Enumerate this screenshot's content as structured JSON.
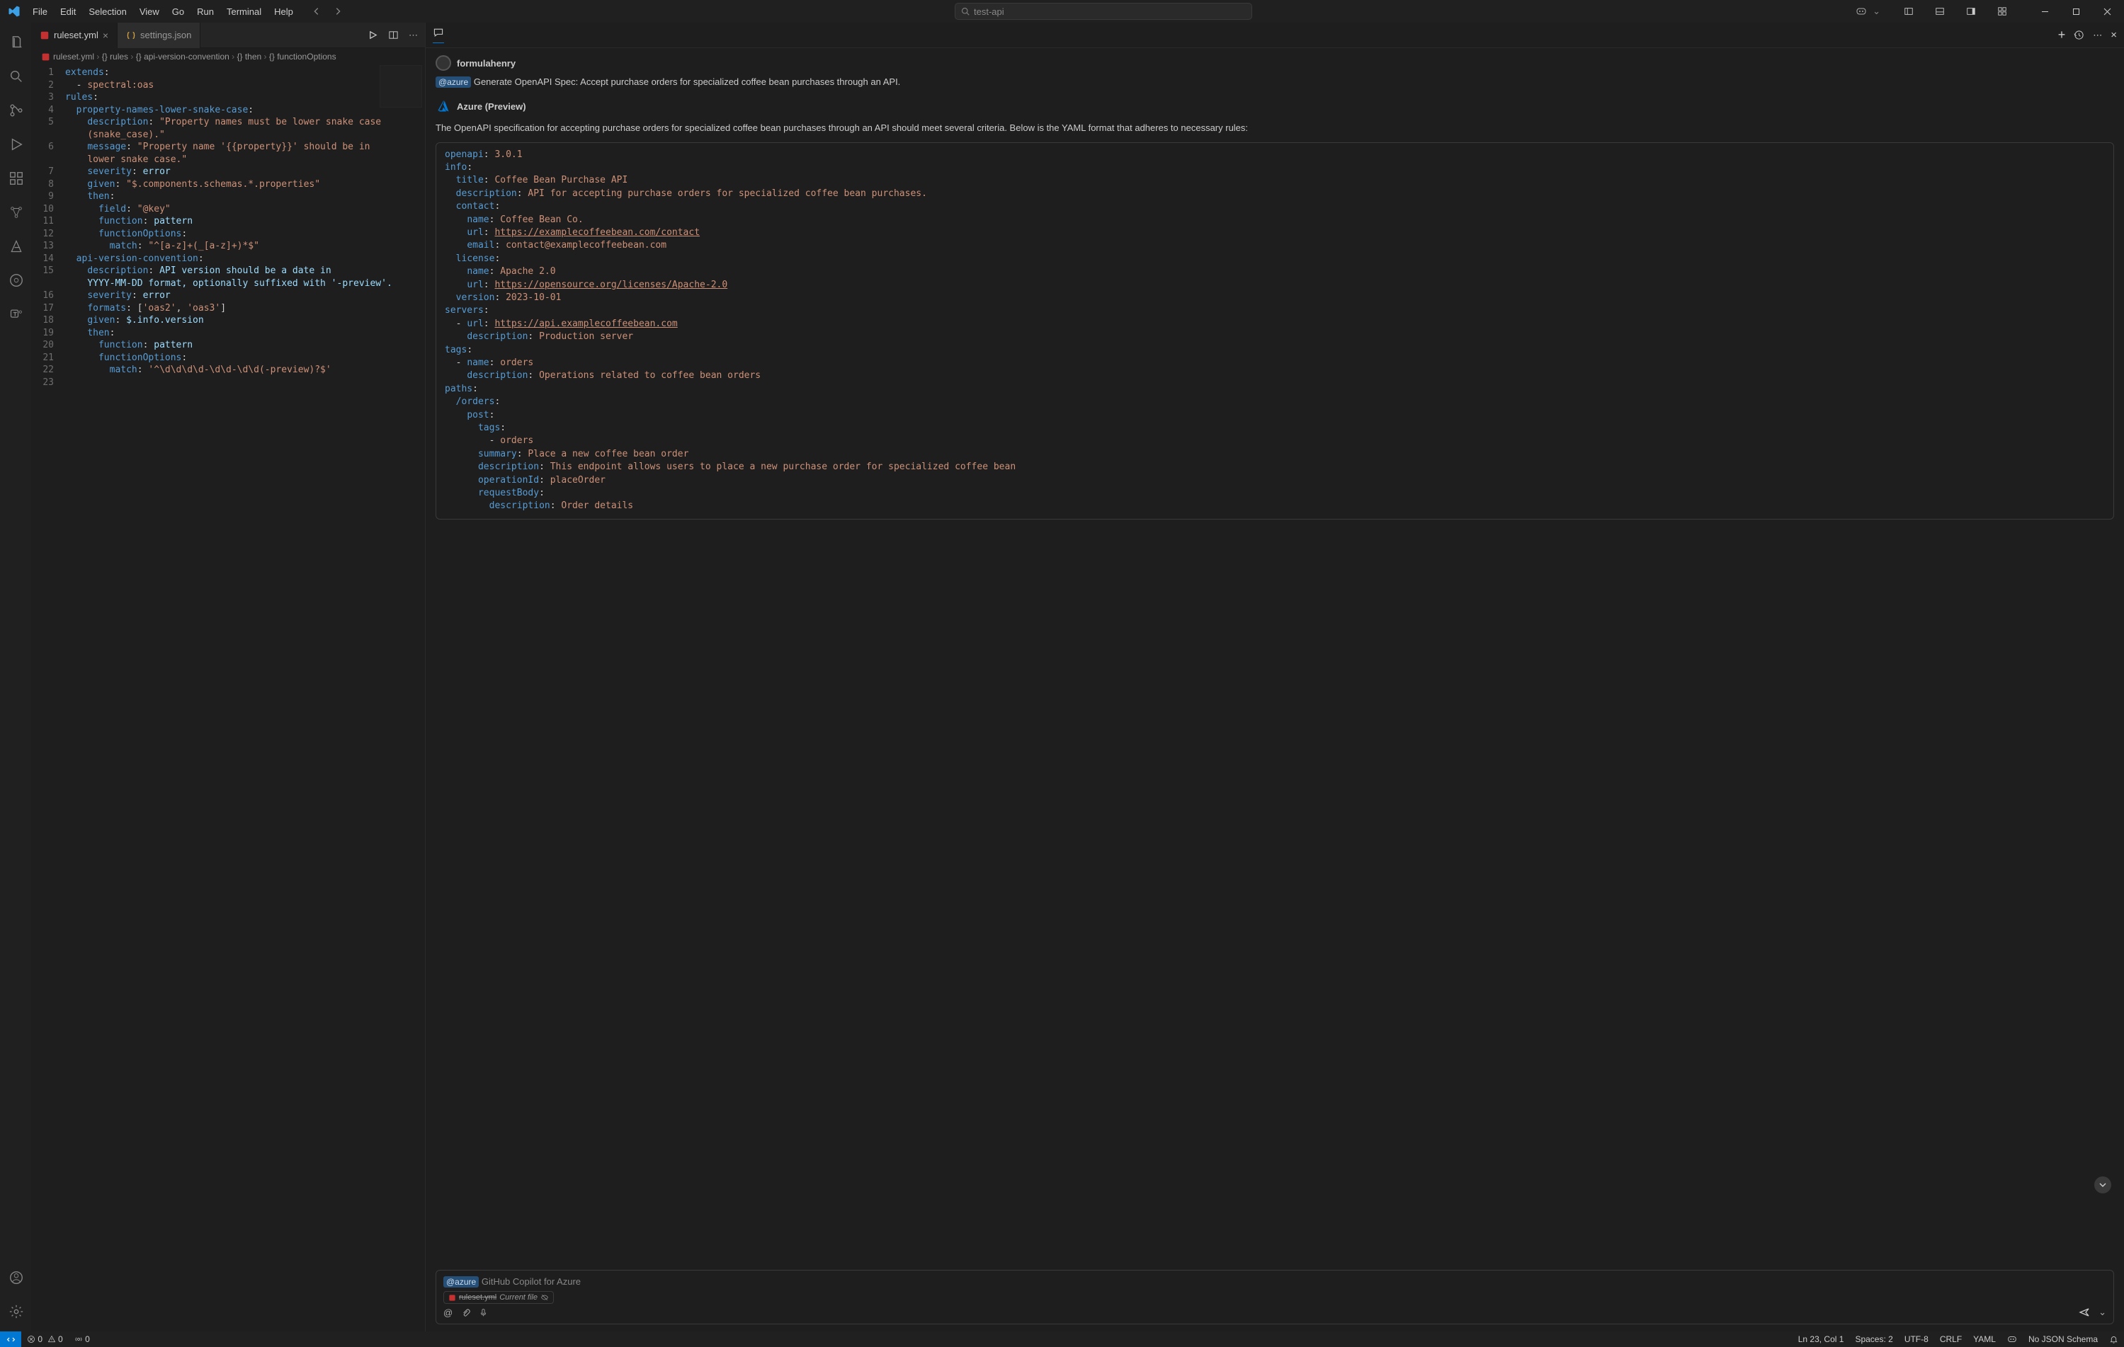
{
  "menu": [
    "File",
    "Edit",
    "Selection",
    "View",
    "Go",
    "Run",
    "Terminal",
    "Help"
  ],
  "search_placeholder": "test-api",
  "tabs": [
    {
      "name": "ruleset.yml",
      "active": true
    },
    {
      "name": "settings.json",
      "active": false
    }
  ],
  "breadcrumb": [
    "ruleset.yml",
    "{} rules",
    "{} api-version-convention",
    "{} then",
    "{} functionOptions"
  ],
  "editor": {
    "lines": [
      [
        [
          "c-key",
          "extends"
        ],
        [
          "",
          ":"
        ]
      ],
      [
        [
          "",
          "  - "
        ],
        [
          "c-str",
          "spectral:oas"
        ]
      ],
      [
        [
          "c-key",
          "rules"
        ],
        [
          "",
          ":"
        ]
      ],
      [
        [
          "",
          "  "
        ],
        [
          "c-key",
          "property-names-lower-snake-case"
        ],
        [
          "",
          ":"
        ]
      ],
      [
        [
          "",
          "    "
        ],
        [
          "c-key",
          "description"
        ],
        [
          "",
          ": "
        ],
        [
          "c-str",
          "\"Property names must be lower snake case"
        ]
      ],
      [
        [
          "",
          "    "
        ],
        [
          "c-str",
          "(snake_case).\""
        ]
      ],
      [
        [
          "",
          "    "
        ],
        [
          "c-key",
          "message"
        ],
        [
          "",
          ": "
        ],
        [
          "c-str",
          "\"Property name '{{property}}' should be in"
        ]
      ],
      [
        [
          "",
          "    "
        ],
        [
          "c-str",
          "lower snake case.\""
        ]
      ],
      [
        [
          "",
          "    "
        ],
        [
          "c-key",
          "severity"
        ],
        [
          "",
          ": "
        ],
        [
          "c-val",
          "error"
        ]
      ],
      [
        [
          "",
          "    "
        ],
        [
          "c-key",
          "given"
        ],
        [
          "",
          ": "
        ],
        [
          "c-str",
          "\"$.components.schemas.*.properties\""
        ]
      ],
      [
        [
          "",
          "    "
        ],
        [
          "c-key",
          "then"
        ],
        [
          "",
          ":"
        ]
      ],
      [
        [
          "",
          "      "
        ],
        [
          "c-key",
          "field"
        ],
        [
          "",
          ": "
        ],
        [
          "c-str",
          "\"@key\""
        ]
      ],
      [
        [
          "",
          "      "
        ],
        [
          "c-key",
          "function"
        ],
        [
          "",
          ": "
        ],
        [
          "c-val",
          "pattern"
        ]
      ],
      [
        [
          "",
          "      "
        ],
        [
          "c-key",
          "functionOptions"
        ],
        [
          "",
          ":"
        ]
      ],
      [
        [
          "",
          "        "
        ],
        [
          "c-key",
          "match"
        ],
        [
          "",
          ": "
        ],
        [
          "c-str",
          "\"^[a-z]+(_[a-z]+)*$\""
        ]
      ],
      [
        [
          "",
          "  "
        ],
        [
          "c-key",
          "api-version-convention"
        ],
        [
          "",
          ":"
        ]
      ],
      [
        [
          "",
          "    "
        ],
        [
          "c-key",
          "description"
        ],
        [
          "",
          ": "
        ],
        [
          "c-val",
          "API version should be a date in"
        ]
      ],
      [
        [
          "",
          "    "
        ],
        [
          "c-val",
          "YYYY-MM-DD format, optionally suffixed with '-preview'."
        ]
      ],
      [
        [
          "",
          "    "
        ],
        [
          "c-key",
          "severity"
        ],
        [
          "",
          ": "
        ],
        [
          "c-val",
          "error"
        ]
      ],
      [
        [
          "",
          "    "
        ],
        [
          "c-key",
          "formats"
        ],
        [
          "",
          ": ["
        ],
        [
          "c-str",
          "'oas2'"
        ],
        [
          "",
          ", "
        ],
        [
          "c-str",
          "'oas3'"
        ],
        [
          "",
          "]"
        ]
      ],
      [
        [
          "",
          "    "
        ],
        [
          "c-key",
          "given"
        ],
        [
          "",
          ": "
        ],
        [
          "c-val",
          "$.info.version"
        ]
      ],
      [
        [
          "",
          "    "
        ],
        [
          "c-key",
          "then"
        ],
        [
          "",
          ":"
        ]
      ],
      [
        [
          "",
          "      "
        ],
        [
          "c-key",
          "function"
        ],
        [
          "",
          ": "
        ],
        [
          "c-val",
          "pattern"
        ]
      ],
      [
        [
          "",
          "      "
        ],
        [
          "c-key",
          "functionOptions"
        ],
        [
          "",
          ":"
        ]
      ],
      [
        [
          "",
          "        "
        ],
        [
          "c-key",
          "match"
        ],
        [
          "",
          ": "
        ],
        [
          "c-str",
          "'^\\d\\d\\d\\d-\\d\\d-\\d\\d(-preview)?$'"
        ]
      ],
      [
        [
          "",
          ""
        ]
      ]
    ],
    "line_numbers": [
      "1",
      "2",
      "3",
      "4",
      "5",
      "",
      "6",
      "",
      "7",
      "8",
      "9",
      "10",
      "11",
      "12",
      "13",
      "14",
      "15",
      "",
      "16",
      "17",
      "18",
      "19",
      "20",
      "21",
      "22",
      "23"
    ]
  },
  "chat": {
    "user": "formulahenry",
    "mention": "@azure",
    "prompt": "Generate OpenAPI Spec: Accept purchase orders for specialized coffee bean purchases through an API.",
    "agent": "Azure (Preview)",
    "desc": "The OpenAPI specification for accepting purchase orders for specialized coffee bean purchases through an API should meet several criteria. Below is the YAML format that adheres to necessary rules:",
    "code_lines": [
      [
        [
          "y-key",
          "openapi"
        ],
        [
          "",
          ": "
        ],
        [
          "y-str",
          "3.0.1"
        ]
      ],
      [
        [
          "y-key",
          "info"
        ],
        [
          "",
          ":"
        ]
      ],
      [
        [
          "",
          "  "
        ],
        [
          "y-key",
          "title"
        ],
        [
          "",
          ": "
        ],
        [
          "y-str",
          "Coffee Bean Purchase API"
        ]
      ],
      [
        [
          "",
          "  "
        ],
        [
          "y-key",
          "description"
        ],
        [
          "",
          ": "
        ],
        [
          "y-str",
          "API for accepting purchase orders for specialized coffee bean purchases."
        ]
      ],
      [
        [
          "",
          "  "
        ],
        [
          "y-key",
          "contact"
        ],
        [
          "",
          ":"
        ]
      ],
      [
        [
          "",
          "    "
        ],
        [
          "y-key",
          "name"
        ],
        [
          "",
          ": "
        ],
        [
          "y-str",
          "Coffee Bean Co."
        ]
      ],
      [
        [
          "",
          "    "
        ],
        [
          "y-key",
          "url"
        ],
        [
          "",
          ": "
        ],
        [
          "y-url",
          "https://examplecoffeebean.com/contact"
        ]
      ],
      [
        [
          "",
          "    "
        ],
        [
          "y-key",
          "email"
        ],
        [
          "",
          ": "
        ],
        [
          "y-str",
          "contact@examplecoffeebean.com"
        ]
      ],
      [
        [
          "",
          "  "
        ],
        [
          "y-key",
          "license"
        ],
        [
          "",
          ":"
        ]
      ],
      [
        [
          "",
          "    "
        ],
        [
          "y-key",
          "name"
        ],
        [
          "",
          ": "
        ],
        [
          "y-str",
          "Apache 2.0"
        ]
      ],
      [
        [
          "",
          "    "
        ],
        [
          "y-key",
          "url"
        ],
        [
          "",
          ": "
        ],
        [
          "y-url",
          "https://opensource.org/licenses/Apache-2.0"
        ]
      ],
      [
        [
          "",
          "  "
        ],
        [
          "y-key",
          "version"
        ],
        [
          "",
          ": "
        ],
        [
          "y-str",
          "2023-10-01"
        ]
      ],
      [
        [
          "y-key",
          "servers"
        ],
        [
          "",
          ":"
        ]
      ],
      [
        [
          "",
          "  - "
        ],
        [
          "y-key",
          "url"
        ],
        [
          "",
          ": "
        ],
        [
          "y-url",
          "https://api.examplecoffeebean.com"
        ]
      ],
      [
        [
          "",
          "    "
        ],
        [
          "y-key",
          "description"
        ],
        [
          "",
          ": "
        ],
        [
          "y-str",
          "Production server"
        ]
      ],
      [
        [
          "y-key",
          "tags"
        ],
        [
          "",
          ":"
        ]
      ],
      [
        [
          "",
          "  - "
        ],
        [
          "y-key",
          "name"
        ],
        [
          "",
          ": "
        ],
        [
          "y-str",
          "orders"
        ]
      ],
      [
        [
          "",
          "    "
        ],
        [
          "y-key",
          "description"
        ],
        [
          "",
          ": "
        ],
        [
          "y-str",
          "Operations related to coffee bean orders"
        ]
      ],
      [
        [
          "y-key",
          "paths"
        ],
        [
          "",
          ":"
        ]
      ],
      [
        [
          "",
          "  "
        ],
        [
          "y-key",
          "/orders"
        ],
        [
          "",
          ":"
        ]
      ],
      [
        [
          "",
          "    "
        ],
        [
          "y-key",
          "post"
        ],
        [
          "",
          ":"
        ]
      ],
      [
        [
          "",
          "      "
        ],
        [
          "y-key",
          "tags"
        ],
        [
          "",
          ":"
        ]
      ],
      [
        [
          "",
          "        - "
        ],
        [
          "y-str",
          "orders"
        ]
      ],
      [
        [
          "",
          "      "
        ],
        [
          "y-key",
          "summary"
        ],
        [
          "",
          ": "
        ],
        [
          "y-str",
          "Place a new coffee bean order"
        ]
      ],
      [
        [
          "",
          "      "
        ],
        [
          "y-key",
          "description"
        ],
        [
          "",
          ": "
        ],
        [
          "y-str",
          "This endpoint allows users to place a new purchase order for specialized coffee bean"
        ]
      ],
      [
        [
          "",
          "      "
        ],
        [
          "y-key",
          "operationId"
        ],
        [
          "",
          ": "
        ],
        [
          "y-str",
          "placeOrder"
        ]
      ],
      [
        [
          "",
          "      "
        ],
        [
          "y-key",
          "requestBody"
        ],
        [
          "",
          ":"
        ]
      ],
      [
        [
          "",
          "        "
        ],
        [
          "y-key",
          "description"
        ],
        [
          "",
          ": "
        ],
        [
          "y-str",
          "Order details"
        ]
      ]
    ],
    "input_placeholder": "GitHub Copilot for Azure",
    "context_file": "ruleset.yml",
    "context_label": "Current file"
  },
  "status": {
    "errors": "0",
    "warnings": "0",
    "ports": "0",
    "pos": "Ln 23, Col 1",
    "spaces": "Spaces: 2",
    "enc": "UTF-8",
    "eol": "CRLF",
    "lang": "YAML",
    "schema": "No JSON Schema"
  }
}
